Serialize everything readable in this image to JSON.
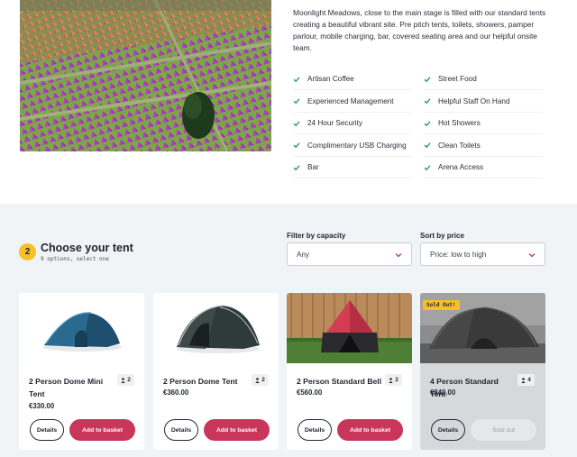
{
  "intro": {
    "description": "Moonlight Meadows, close to the main stage is filled  with our standard tents creating a beautiful vibrant site. Pre pitch tents, toilets, showers, pamper parlour, mobile charging, bar, covered seating area and our helpful onsite team.",
    "hero_alt": "Aerial view of festival campsite with rows of purple tents"
  },
  "amenities": {
    "left": [
      "Artisan Coffee",
      "Experienced Management",
      "24 Hour Security",
      "Complimentary USB Charging",
      "Bar"
    ],
    "right": [
      "Street Food",
      "Helpful Staff On Hand",
      "Hot Showers",
      "Clean Toilets",
      "Arena Access"
    ],
    "check_color": "#2f9e5a"
  },
  "chooser": {
    "step_number": "2",
    "title": "Choose your tent",
    "subtitle": "9 options, select one"
  },
  "filters": {
    "capacity_label": "Filter by capacity",
    "capacity_value": "Any",
    "sort_label": "Sort by price",
    "sort_value": "Price: low to high"
  },
  "tents": [
    {
      "name": "2 Person Dome Mini Tent",
      "price": "€330.00",
      "capacity": "2",
      "details_label": "Details",
      "action_label": "Add to basket",
      "sold_out": false
    },
    {
      "name": "2 Person Dome Tent",
      "price": "€360.00",
      "capacity": "2",
      "details_label": "Details",
      "action_label": "Add to basket",
      "sold_out": false
    },
    {
      "name": "2 Person Standard Bell",
      "price": "€560.00",
      "capacity": "2",
      "details_label": "Details",
      "action_label": "Add to basket",
      "sold_out": false
    },
    {
      "name": "4 Person Standard Tent",
      "price": "€840.00",
      "capacity": "4",
      "details_label": "Details",
      "action_label": "Sold out",
      "sold_out": true,
      "badge": "Sold Out!"
    }
  ],
  "colors": {
    "accent": "#c8375a",
    "badge_yellow": "#f7c026",
    "panel_bg": "#f1f4f6"
  },
  "icons": {
    "check": "check-icon",
    "chevron": "chevron-down-icon",
    "person": "person-icon"
  }
}
